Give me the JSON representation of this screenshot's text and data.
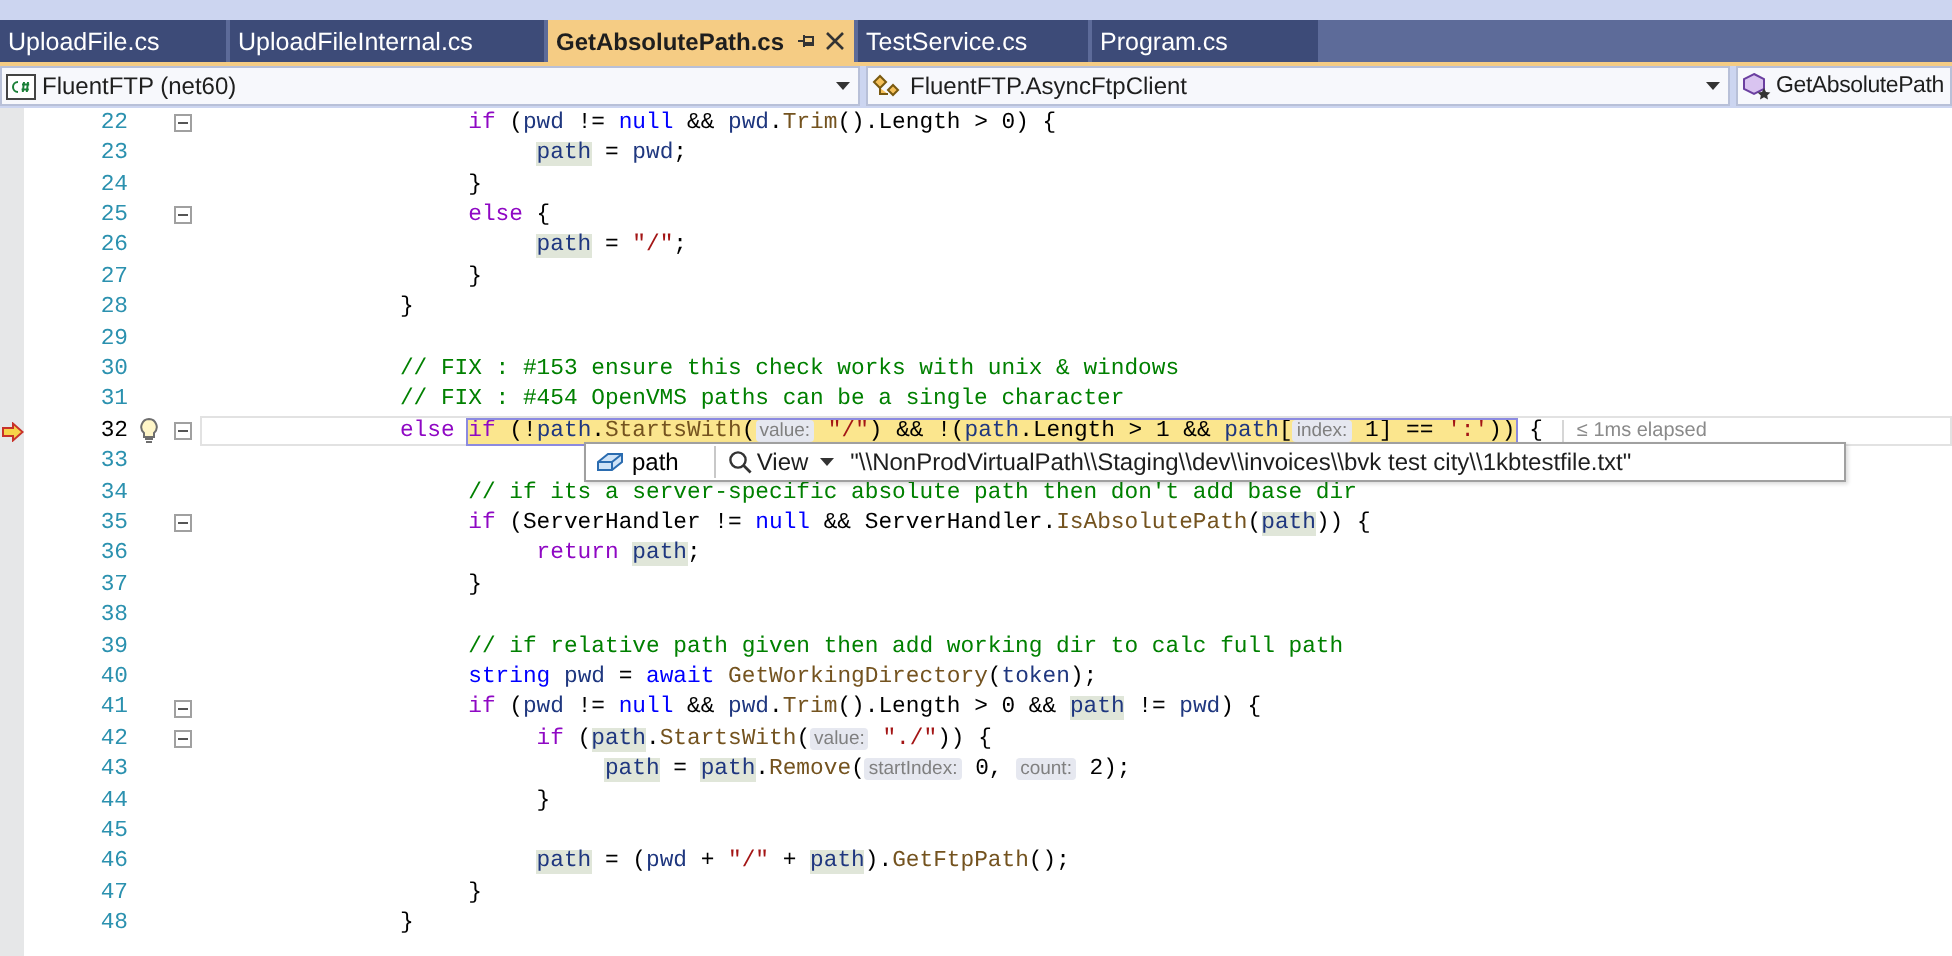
{
  "tabs": [
    {
      "label": "UploadFile.cs",
      "selected": false
    },
    {
      "label": "UploadFileInternal.cs",
      "selected": false
    },
    {
      "label": "GetAbsolutePath.cs",
      "selected": true
    },
    {
      "label": "TestService.cs",
      "selected": false
    },
    {
      "label": "Program.cs",
      "selected": false
    }
  ],
  "navigation_bar": {
    "project": "FluentFTP (net60)",
    "type": "FluentFTP.AsyncFtpClient",
    "member": "GetAbsolutePath"
  },
  "editor": {
    "lines": [
      {
        "children": [
          {
            "number": "22",
            "current": false,
            "collapsible": true,
            "tokens": [
              {
                "kind": "ctl",
                "text": "if"
              },
              {
                "kind": "plain",
                "text": " ("
              },
              {
                "kind": "local",
                "text": "pwd"
              },
              {
                "kind": "plain",
                "text": " != "
              },
              {
                "kind": "kw",
                "text": "null"
              },
              {
                "kind": "plain",
                "text": " && "
              },
              {
                "kind": "local",
                "text": "pwd"
              },
              {
                "kind": "plain",
                "text": "."
              },
              {
                "kind": "method",
                "text": "Trim"
              },
              {
                "kind": "plain",
                "text": "().Length > 0) {"
              }
            ],
            "children": [
              {
                "number": "23",
                "current": false,
                "collapsible": false,
                "tokens": [
                  {
                    "kind": "ref",
                    "text": "path"
                  },
                  {
                    "kind": "plain",
                    "text": " = "
                  },
                  {
                    "kind": "local",
                    "text": "pwd"
                  },
                  {
                    "kind": "plain",
                    "text": ";"
                  }
                ]
              }
            ]
          },
          {
            "number": "24",
            "current": false,
            "collapsible": false,
            "tokens": [
              {
                "kind": "plain",
                "text": "}"
              }
            ]
          },
          {
            "number": "25",
            "current": false,
            "collapsible": true,
            "tokens": [
              {
                "kind": "ctl",
                "text": "else"
              },
              {
                "kind": "plain",
                "text": " {"
              }
            ],
            "children": [
              {
                "number": "26",
                "current": false,
                "collapsible": false,
                "tokens": [
                  {
                    "kind": "ref",
                    "text": "path"
                  },
                  {
                    "kind": "plain",
                    "text": " = "
                  },
                  {
                    "kind": "str",
                    "text": "\"/\""
                  },
                  {
                    "kind": "plain",
                    "text": ";"
                  }
                ]
              }
            ]
          },
          {
            "number": "27",
            "current": false,
            "collapsible": false,
            "tokens": [
              {
                "kind": "plain",
                "text": "}"
              }
            ]
          }
        ]
      },
      {
        "number": "28",
        "current": false,
        "collapsible": false,
        "tokens": [
          {
            "kind": "plain",
            "text": "}"
          }
        ]
      },
      {
        "number": "29",
        "current": false,
        "collapsible": false
      },
      {
        "number": "30",
        "current": false,
        "collapsible": false,
        "tokens": [
          {
            "kind": "comment",
            "text": "// FIX : #153 ensure this check works with unix & windows"
          }
        ]
      },
      {
        "number": "31",
        "current": false,
        "collapsible": false,
        "tokens": [
          {
            "kind": "comment",
            "text": "// FIX : #454 OpenVMS paths can be a single character"
          }
        ]
      },
      {
        "number": "32",
        "current": true,
        "collapsible": true,
        "tokens": [
          {
            "kind": "ctl",
            "text": "else "
          },
          {
            "kind": "statement",
            "tokens": [
              {
                "kind": "ctl",
                "text": "if"
              },
              {
                "kind": "plain",
                "text": " (!"
              },
              {
                "kind": "local",
                "text": "path"
              },
              {
                "kind": "plain",
                "text": "."
              },
              {
                "kind": "method",
                "text": "StartsWith"
              },
              {
                "kind": "plain",
                "text": "("
              },
              {
                "kind": "hint",
                "text": "value:"
              },
              {
                "kind": "str",
                "text": " \"/\""
              },
              {
                "kind": "plain",
                "text": ") && !("
              },
              {
                "kind": "local",
                "text": "path"
              },
              {
                "kind": "plain",
                "text": ".Length > 1 && "
              },
              {
                "kind": "local",
                "text": "path"
              },
              {
                "kind": "plain",
                "text": "["
              },
              {
                "kind": "hint",
                "text": "index:"
              },
              {
                "kind": "plain",
                "text": " 1] == "
              },
              {
                "kind": "str",
                "text": "':'"
              },
              {
                "kind": "plain",
                "text": "))"
              }
            ]
          },
          {
            "kind": "plain",
            "text": " {"
          }
        ],
        "elapsed": "≤ 1ms elapsed",
        "datatip": {
          "name": "path",
          "action": "View",
          "value": "\"\\\\NonProdVirtualPath\\\\Staging\\\\dev\\\\invoices\\\\bvk test city\\\\1kbtestfile.txt\""
        },
        "children": [
          {
            "number": "33",
            "current": false,
            "collapsible": false
          },
          {
            "number": "34",
            "current": false,
            "collapsible": false,
            "tokens": [
              {
                "kind": "comment",
                "text": "// if its a server-specific absolute path then don't add base dir"
              }
            ]
          },
          {
            "number": "35",
            "current": false,
            "collapsible": true,
            "tokens": [
              {
                "kind": "ctl",
                "text": "if"
              },
              {
                "kind": "plain",
                "text": " (ServerHandler != "
              },
              {
                "kind": "kw",
                "text": "null"
              },
              {
                "kind": "plain",
                "text": " && ServerHandler."
              },
              {
                "kind": "method",
                "text": "IsAbsolutePath"
              },
              {
                "kind": "plain",
                "text": "("
              },
              {
                "kind": "ref",
                "text": "path"
              },
              {
                "kind": "plain",
                "text": ")) {"
              }
            ],
            "children": [
              {
                "number": "36",
                "current": false,
                "collapsible": false,
                "tokens": [
                  {
                    "kind": "ctl",
                    "text": "return "
                  },
                  {
                    "kind": "ref",
                    "text": "path"
                  },
                  {
                    "kind": "plain",
                    "text": ";"
                  }
                ]
              }
            ]
          },
          {
            "number": "37",
            "current": false,
            "collapsible": false,
            "tokens": [
              {
                "kind": "plain",
                "text": "}"
              }
            ]
          },
          {
            "number": "38",
            "current": false,
            "collapsible": false
          },
          {
            "number": "39",
            "current": false,
            "collapsible": false,
            "tokens": [
              {
                "kind": "comment",
                "text": "// if relative path given then add working dir to calc full path"
              }
            ]
          },
          {
            "number": "40",
            "current": false,
            "collapsible": false,
            "tokens": [
              {
                "kind": "kw",
                "text": "string "
              },
              {
                "kind": "local",
                "text": "pwd"
              },
              {
                "kind": "plain",
                "text": " = "
              },
              {
                "kind": "kw",
                "text": "await "
              },
              {
                "kind": "method",
                "text": "GetWorkingDirectory"
              },
              {
                "kind": "plain",
                "text": "("
              },
              {
                "kind": "local",
                "text": "token"
              },
              {
                "kind": "plain",
                "text": ");"
              }
            ]
          },
          {
            "number": "41",
            "current": false,
            "collapsible": true,
            "tokens": [
              {
                "kind": "ctl",
                "text": "if"
              },
              {
                "kind": "plain",
                "text": " ("
              },
              {
                "kind": "local",
                "text": "pwd"
              },
              {
                "kind": "plain",
                "text": " != "
              },
              {
                "kind": "kw",
                "text": "null"
              },
              {
                "kind": "plain",
                "text": " && "
              },
              {
                "kind": "local",
                "text": "pwd"
              },
              {
                "kind": "plain",
                "text": "."
              },
              {
                "kind": "method",
                "text": "Trim"
              },
              {
                "kind": "plain",
                "text": "().Length > 0 && "
              },
              {
                "kind": "ref",
                "text": "path"
              },
              {
                "kind": "plain",
                "text": " != "
              },
              {
                "kind": "local",
                "text": "pwd"
              },
              {
                "kind": "plain",
                "text": ") {"
              }
            ],
            "children": [
              {
                "number": "42",
                "current": false,
                "collapsible": true,
                "tokens": [
                  {
                    "kind": "ctl",
                    "text": "if"
                  },
                  {
                    "kind": "plain",
                    "text": " ("
                  },
                  {
                    "kind": "ref",
                    "text": "path"
                  },
                  {
                    "kind": "plain",
                    "text": "."
                  },
                  {
                    "kind": "method",
                    "text": "StartsWith"
                  },
                  {
                    "kind": "plain",
                    "text": "("
                  },
                  {
                    "kind": "hint",
                    "text": "value:"
                  },
                  {
                    "kind": "str",
                    "text": " \"./\""
                  },
                  {
                    "kind": "plain",
                    "text": ")) {"
                  }
                ],
                "children": [
                  {
                    "number": "43",
                    "current": false,
                    "collapsible": false,
                    "tokens": [
                      {
                        "kind": "ref",
                        "text": "path"
                      },
                      {
                        "kind": "plain",
                        "text": " = "
                      },
                      {
                        "kind": "ref",
                        "text": "path"
                      },
                      {
                        "kind": "plain",
                        "text": "."
                      },
                      {
                        "kind": "method",
                        "text": "Remove"
                      },
                      {
                        "kind": "plain",
                        "text": "("
                      },
                      {
                        "kind": "hint",
                        "text": "startIndex:"
                      },
                      {
                        "kind": "plain",
                        "text": " 0, "
                      },
                      {
                        "kind": "hint",
                        "text": "count:"
                      },
                      {
                        "kind": "plain",
                        "text": " 2);"
                      }
                    ]
                  }
                ]
              },
              {
                "number": "44",
                "current": false,
                "collapsible": false,
                "tokens": [
                  {
                    "kind": "plain",
                    "text": "}"
                  }
                ]
              },
              {
                "number": "45",
                "current": false,
                "collapsible": false
              },
              {
                "number": "46",
                "current": false,
                "collapsible": false,
                "tokens": [
                  {
                    "kind": "ref",
                    "text": "path"
                  },
                  {
                    "kind": "plain",
                    "text": " = ("
                  },
                  {
                    "kind": "local",
                    "text": "pwd"
                  },
                  {
                    "kind": "plain",
                    "text": " + "
                  },
                  {
                    "kind": "str",
                    "text": "\"/\""
                  },
                  {
                    "kind": "plain",
                    "text": " + "
                  },
                  {
                    "kind": "ref",
                    "text": "path"
                  },
                  {
                    "kind": "plain",
                    "text": ")."
                  },
                  {
                    "kind": "method",
                    "text": "GetFtpPath"
                  },
                  {
                    "kind": "plain",
                    "text": "();"
                  }
                ]
              }
            ]
          },
          {
            "number": "47",
            "current": false,
            "collapsible": false,
            "tokens": [
              {
                "kind": "plain",
                "text": "}"
              }
            ]
          }
        ]
      },
      {
        "number": "48",
        "current": false,
        "collapsible": false,
        "tokens": [
          {
            "kind": "plain",
            "text": "}"
          }
        ]
      }
    ]
  }
}
